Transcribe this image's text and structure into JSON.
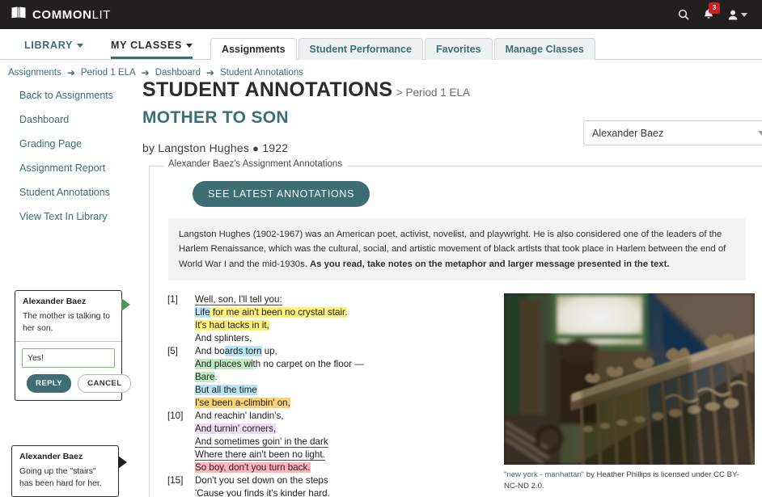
{
  "brand": {
    "name_bold": "COMMON",
    "name_light": "LIT",
    "logo_icon": "book-icon",
    "accent": "#3c6e74",
    "topbar_bg": "#221f20"
  },
  "topbar": {
    "search_icon": "search-icon",
    "notifications_icon": "bell-icon",
    "notification_count": "3",
    "account_icon": "user-icon"
  },
  "nav": {
    "items": [
      {
        "label": "LIBRARY",
        "has_caret": true,
        "active": false
      },
      {
        "label": "MY CLASSES",
        "has_caret": true,
        "active": true
      }
    ],
    "tabs": [
      {
        "label": "Assignments",
        "active": true
      },
      {
        "label": "Student Performance",
        "active": false
      },
      {
        "label": "Favorites",
        "active": false
      },
      {
        "label": "Manage Classes",
        "active": false
      }
    ]
  },
  "breadcrumb": {
    "items": [
      "Assignments",
      "Period 1 ELA",
      "Dashboard",
      "Student Annotations"
    ],
    "separator": "➔"
  },
  "sidebar": {
    "items": [
      {
        "label": "Back to Assignments"
      },
      {
        "label": "Dashboard"
      },
      {
        "label": "Grading Page"
      },
      {
        "label": "Assignment Report"
      },
      {
        "label": "Student Annotations"
      },
      {
        "label": "View Text In Library"
      }
    ]
  },
  "header": {
    "title": "STUDENT ANNOTATIONS",
    "title_suffix": "> Period 1 ELA",
    "work_title": "MOTHER TO SON",
    "byline": "by Langston Hughes",
    "byline_dot": "●",
    "byline_year": "1922"
  },
  "student_select": {
    "value": "Alexander Baez",
    "icon": "chevron-down-icon"
  },
  "panel": {
    "legend": "Alexander Baez's Assignment Annotations",
    "see_latest_button": "SEE LATEST ANNOTATIONS"
  },
  "bio": {
    "part1": "Langston Hughes (1902-1967) was an American poet, activist, novelist, and playwright. He is also considered one of the leaders of the Harlem Renaissance, which was the cultural, social, and artistic movement of black artists that took place in Harlem between the end of World War I and the mid-1930s. ",
    "bold": "As you read, take notes on the metaphor and larger message presented in the text.",
    "part2": ""
  },
  "poem": {
    "lines": [
      {
        "num": "[1]",
        "segments": [
          {
            "text": "Well, son, I'll tell you:",
            "style": "ul"
          }
        ]
      },
      {
        "num": "",
        "segments": [
          {
            "text": "Life",
            "style": "hl-b"
          },
          {
            "text": " for me ain't been no crystal stair.",
            "style": "hl-y"
          }
        ]
      },
      {
        "num": "",
        "segments": [
          {
            "text": "It's had tacks in it,",
            "style": "hl-y"
          }
        ]
      },
      {
        "num": "",
        "segments": [
          {
            "text": "And splinters,",
            "style": ""
          }
        ]
      },
      {
        "num": "[5]",
        "segments": [
          {
            "text": "And bo",
            "style": ""
          },
          {
            "text": "ards torn",
            "style": "hl-b"
          },
          {
            "text": " up,",
            "style": ""
          }
        ]
      },
      {
        "num": "",
        "segments": [
          {
            "text": "And places wi",
            "style": "hl-g"
          },
          {
            "text": "th no carpet on the floor —",
            "style": ""
          }
        ]
      },
      {
        "num": "",
        "segments": [
          {
            "text": "Bare",
            "style": "hl-g"
          },
          {
            "text": ".",
            "style": ""
          }
        ]
      },
      {
        "num": "",
        "segments": [
          {
            "text": "But all the time",
            "style": "hl-b"
          }
        ]
      },
      {
        "num": "",
        "segments": [
          {
            "text": "I'se been a-climbin' on,",
            "style": "hl-y2"
          }
        ]
      },
      {
        "num": "[10]",
        "segments": [
          {
            "text": "And reachin' landin's,",
            "style": ""
          }
        ]
      },
      {
        "num": "",
        "segments": [
          {
            "text": "And turnin' corners,",
            "style": "hl-p"
          }
        ]
      },
      {
        "num": "",
        "segments": [
          {
            "text": "And sometimes goin' in the dark",
            "style": "ul"
          }
        ]
      },
      {
        "num": "",
        "segments": [
          {
            "text": "Where there ain't been no light.",
            "style": "ul"
          }
        ]
      },
      {
        "num": "",
        "segments": [
          {
            "text": "So boy, don't you turn back.",
            "style": "hl-r"
          }
        ]
      },
      {
        "num": "[15]",
        "segments": [
          {
            "text": "Don't you set down on the steps",
            "style": ""
          }
        ]
      },
      {
        "num": "",
        "segments": [
          {
            "text": "'Cause you finds it's kinder hard.",
            "style": ""
          }
        ]
      }
    ]
  },
  "figure": {
    "alt": "staircase-railing-photo",
    "caption_link": "\"new york - manhattan\"",
    "caption_rest": " by Heather Phillips is licensed under CC BY-NC-ND 2.0."
  },
  "annotations": [
    {
      "author": "Alexander Baez",
      "text": "The mother is talking to her son.",
      "reply_value": "Yes!",
      "reply_placeholder": "",
      "reply_button": "REPLY",
      "cancel_button": "CANCEL",
      "tail": "green"
    },
    {
      "author": "Alexander Baez",
      "text": "Going up the \"stairs\" has been hard for her.",
      "tail": "black"
    }
  ]
}
